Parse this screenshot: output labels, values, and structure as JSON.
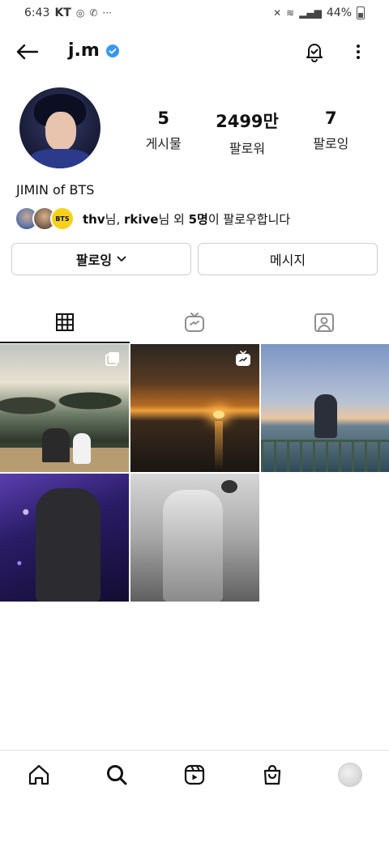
{
  "status_bar": {
    "time": "6:43",
    "carrier": "KT",
    "dots": "···",
    "battery": "44%"
  },
  "header": {
    "username": "j.m"
  },
  "profile": {
    "stats": [
      {
        "value": "5",
        "label": "게시물"
      },
      {
        "value": "2499만",
        "label": "팔로워"
      },
      {
        "value": "7",
        "label": "팔로잉"
      }
    ],
    "name": "JIMIN of BTS",
    "mutual": {
      "avatar3_text": "BTS",
      "user1": "thv",
      "suffix1": "님, ",
      "user2": "rkive",
      "suffix2": "님 외 ",
      "count": "5명",
      "suffix3": "이 팔로우합니다"
    }
  },
  "actions": {
    "follow_label": "팔로잉",
    "message_label": "메시지"
  },
  "tabs": [
    "grid",
    "igtv",
    "tagged"
  ],
  "posts": [
    {
      "badge": "carousel-icon"
    },
    {
      "badge": "igtv-icon"
    },
    {
      "badge": ""
    },
    {
      "badge": ""
    },
    {
      "badge": ""
    }
  ],
  "colors": {
    "verified": "#3897f0",
    "border": "#cfcfcf"
  }
}
